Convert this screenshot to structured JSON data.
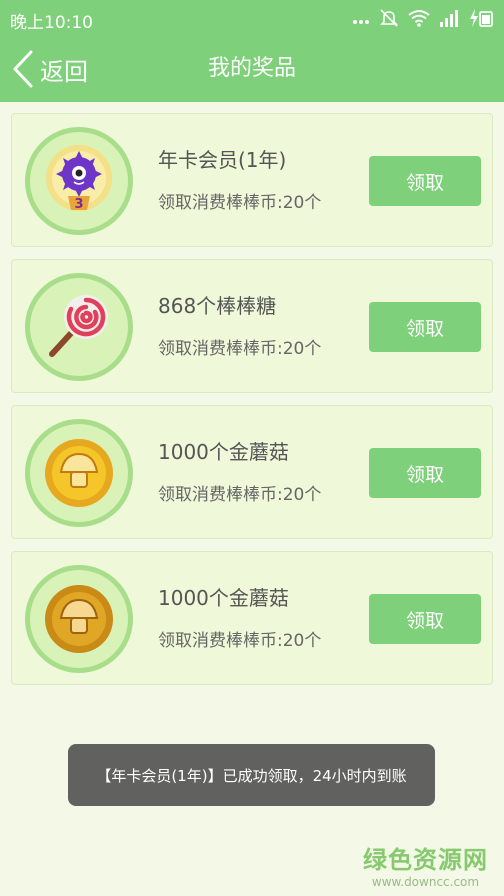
{
  "status_bar": {
    "time": "晚上10:10",
    "icons": [
      "signal-dots-icon",
      "mute-icon",
      "wifi-icon",
      "cell-signal-icon",
      "charging-icon"
    ]
  },
  "header": {
    "back_label": "返回",
    "title": "我的奖品"
  },
  "prizes": [
    {
      "name": "年卡会员(1年)",
      "cost": "领取消费棒棒币:20个",
      "button": "领取",
      "icon": "purple-monster-badge-icon"
    },
    {
      "name": "868个棒棒糖",
      "cost": "领取消费棒棒币:20个",
      "button": "领取",
      "icon": "lollipop-icon"
    },
    {
      "name": "1000个金蘑菇",
      "cost": "领取消费棒棒币:20个",
      "button": "领取",
      "icon": "gold-mushroom-coin-icon"
    },
    {
      "name": "1000个金蘑菇",
      "cost": "领取消费棒棒币:20个",
      "button": "领取",
      "icon": "gold-mushroom-coin-icon"
    }
  ],
  "badge_number": "3",
  "toast": {
    "message": "【年卡会员(1年)】已成功领取，24小时内到账"
  },
  "watermark": {
    "main": "绿色资源网",
    "sub": "www.downcc.com"
  },
  "colors": {
    "primary_green": "#7ed07a",
    "page_background": "#f3f9e6",
    "card_background": "#eff8d9"
  }
}
